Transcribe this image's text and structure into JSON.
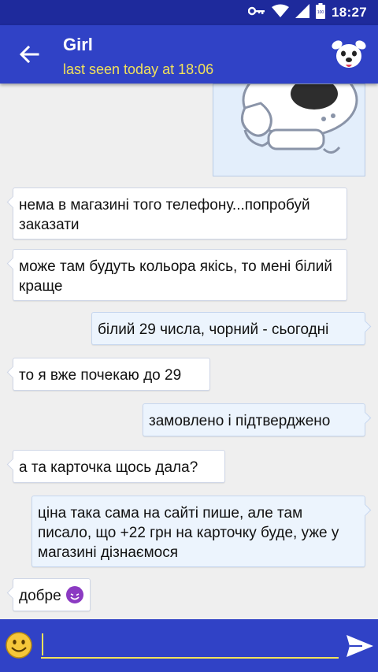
{
  "status_bar": {
    "time": "18:27",
    "icons": [
      "key-icon",
      "wifi-icon",
      "signal-icon",
      "battery-icon"
    ],
    "battery_level": "100"
  },
  "header": {
    "contact_name": "Girl",
    "last_seen": "last seen today at 18:06",
    "back_icon": "arrow-left-icon",
    "avatar_icon": "dog-avatar-icon"
  },
  "messages": [
    {
      "direction": "in",
      "text": "нема в магазині того телефону...попробуй заказати"
    },
    {
      "direction": "in",
      "text": "може там будуть кольора якісь, то мені білий краще"
    },
    {
      "direction": "out",
      "text": "білий 29 числа, чорний - сьогодні"
    },
    {
      "direction": "in",
      "text": "то я вже почекаю до 29"
    },
    {
      "direction": "out",
      "text": "замовлено і підтверджено"
    },
    {
      "direction": "in",
      "text": "а та карточка щось дала?"
    },
    {
      "direction": "out",
      "text": "ціна така сама на сайті пише, але там писало, що +22 грн на карточку буде, уже у магазині дізнаємося"
    },
    {
      "direction": "in",
      "text": "добре",
      "emoji": "devil-emoji"
    }
  ],
  "composer": {
    "value": "",
    "emoji_icon": "smiley-icon",
    "send_icon": "send-icon"
  },
  "colors": {
    "status_bar": "#1e2a9c",
    "app_bar": "#3042c6",
    "accent_yellow": "#f2e25a",
    "incoming_bubble": "#ffffff",
    "outgoing_bubble": "#ecf4fd"
  }
}
